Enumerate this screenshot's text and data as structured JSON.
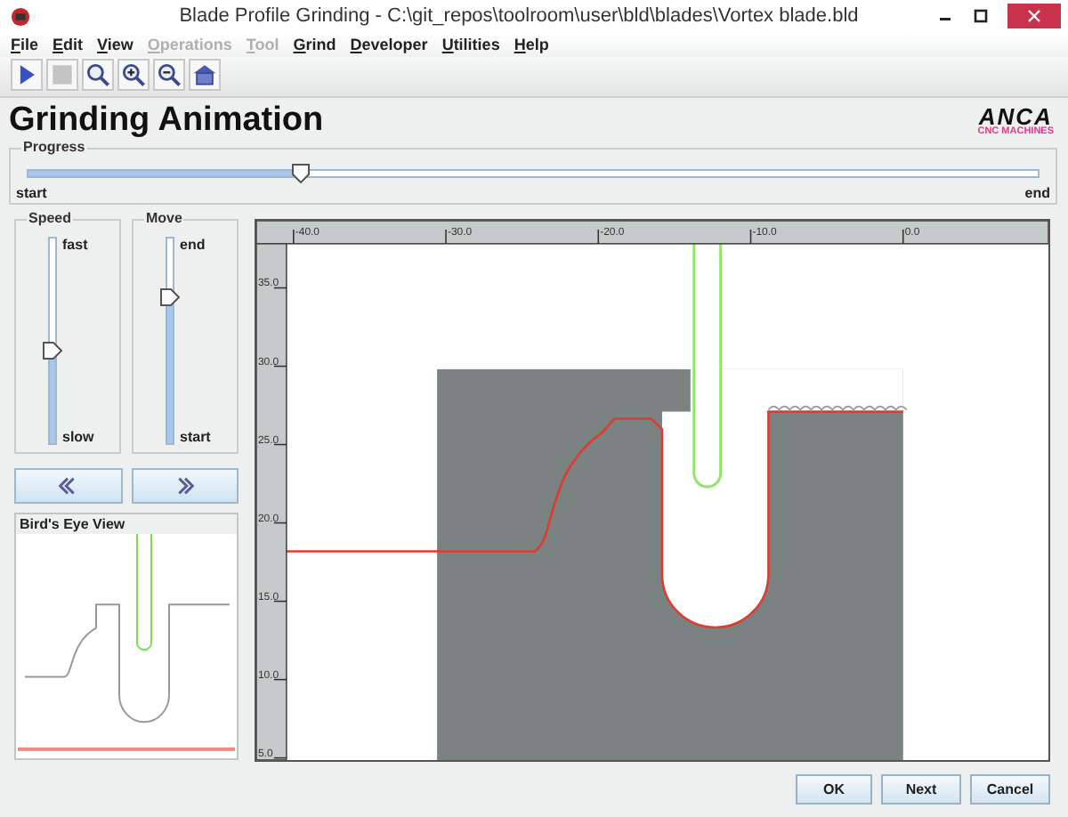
{
  "window": {
    "title": "Blade Profile Grinding - C:\\git_repos\\toolroom\\user\\bld\\blades\\Vortex blade.bld"
  },
  "menu": [
    {
      "label": "File",
      "disabled": false
    },
    {
      "label": "Edit",
      "disabled": false
    },
    {
      "label": "View",
      "disabled": false
    },
    {
      "label": "Operations",
      "disabled": true
    },
    {
      "label": "Tool",
      "disabled": true
    },
    {
      "label": "Grind",
      "disabled": false
    },
    {
      "label": "Developer",
      "disabled": false
    },
    {
      "label": "Utilities",
      "disabled": false
    },
    {
      "label": "Help",
      "disabled": false
    }
  ],
  "toolbar": [
    {
      "kind": "play",
      "disabled": false
    },
    {
      "kind": "stop",
      "disabled": true
    },
    {
      "kind": "zoom",
      "disabled": false
    },
    {
      "kind": "zoom-in",
      "disabled": false
    },
    {
      "kind": "zoom-out",
      "disabled": false
    },
    {
      "kind": "home",
      "disabled": false
    }
  ],
  "heading": "Grinding Animation",
  "logo": {
    "name": "ANCA",
    "tagline": "CNC MACHINES"
  },
  "progress": {
    "title": "Progress",
    "level": 0.27,
    "min_label": "start",
    "max_label": "end"
  },
  "sliders": [
    {
      "title": "Speed",
      "level": 0.45,
      "max_label": "fast",
      "min_label": "slow"
    },
    {
      "title": "Move",
      "level": 0.71,
      "max_label": "end",
      "min_label": "start"
    }
  ],
  "nav_buttons": [
    {
      "kind": "prev"
    },
    {
      "kind": "next"
    }
  ],
  "birds_eye": {
    "title": "Bird's Eye View"
  },
  "canvas": {
    "x_ticks": [
      "-40.0",
      "-30.0",
      "-20.0",
      "-10.0",
      "0.0"
    ],
    "y_ticks": [
      "35.0",
      "30.0",
      "25.0",
      "20.0",
      "15.0",
      "10.0",
      "5.0"
    ]
  },
  "buttons": [
    "OK",
    "Next",
    "Cancel"
  ]
}
